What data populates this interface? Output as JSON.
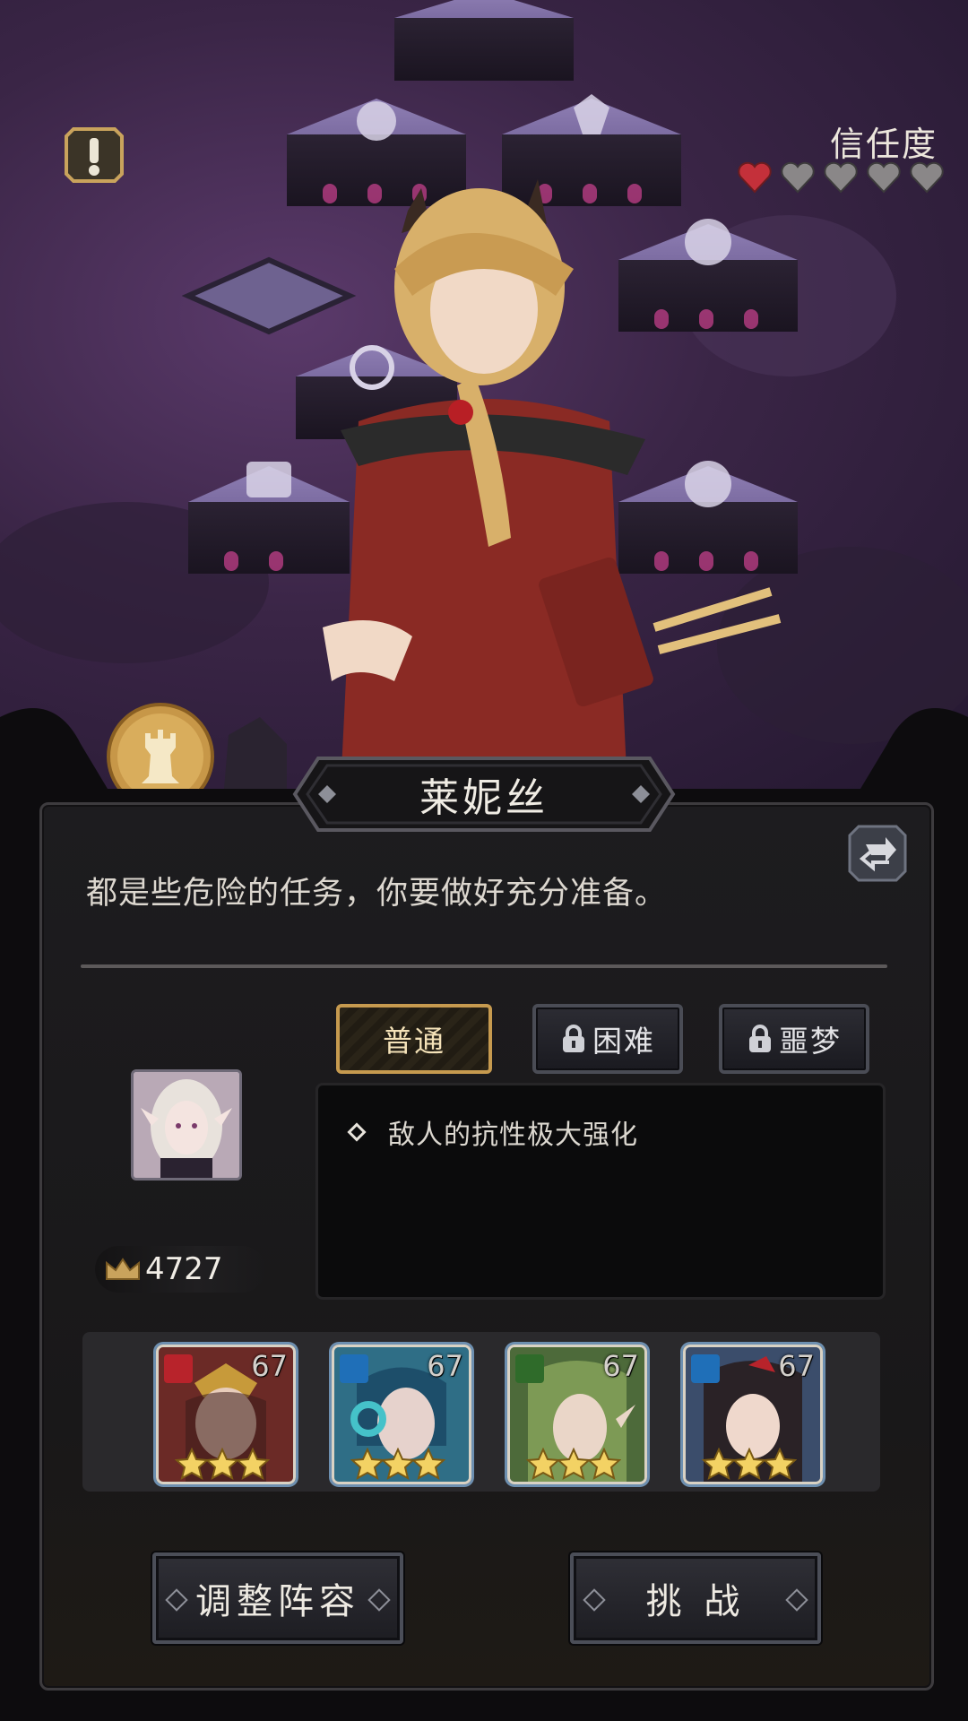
{
  "trust": {
    "label": "信任度",
    "level": 1,
    "max": 5
  },
  "character": {
    "name": "莱妮丝",
    "dialogue": "都是些危险的任务，你要做好充分准备。"
  },
  "difficulty": {
    "options": [
      {
        "label": "普通",
        "locked": false,
        "selected": true
      },
      {
        "label": "困难",
        "locked": true,
        "selected": false
      },
      {
        "label": "噩梦",
        "locked": true,
        "selected": false
      }
    ]
  },
  "enemy": {
    "power": "4727",
    "effect": "敌人的抗性极大强化"
  },
  "team": [
    {
      "level": "67",
      "element": "fire",
      "element_color": "#b8232b",
      "stars": 3
    },
    {
      "level": "67",
      "element": "water",
      "element_color": "#1f6fb8",
      "stars": 3
    },
    {
      "level": "67",
      "element": "nature",
      "element_color": "#2f6b2a",
      "stars": 3
    },
    {
      "level": "67",
      "element": "water",
      "element_color": "#1f6fb8",
      "stars": 3
    }
  ],
  "buttons": {
    "adjust_team": "调整阵容",
    "challenge": "挑 战"
  },
  "colors": {
    "heart_active": "#c4303a",
    "heart_inactive": "#8a8788",
    "accent_gold": "#c69a4f"
  }
}
